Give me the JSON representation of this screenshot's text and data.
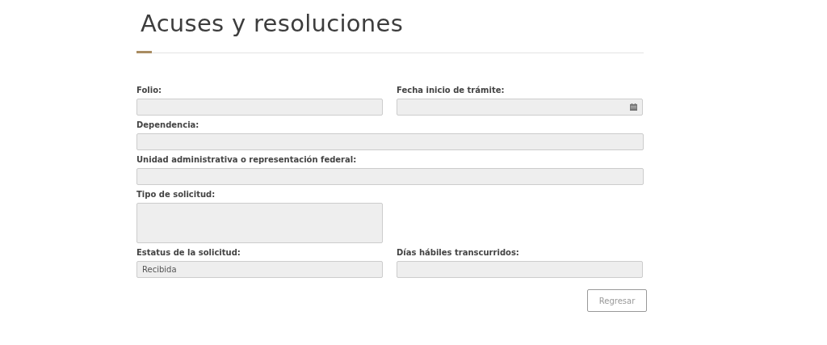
{
  "title": "Acuses y resoluciones",
  "rows": [
    [
      {
        "label": "Folio:",
        "kind": "text"
      },
      {
        "label": "Fecha inicio de trámite:",
        "kind": "date"
      }
    ],
    [
      {
        "label": "Dependencia:",
        "kind": "text"
      }
    ],
    [
      {
        "label": "Unidad administrativa o representación federal:",
        "kind": "text"
      }
    ],
    [
      {
        "label": "Tipo de solicitud:",
        "kind": "textarea"
      }
    ],
    [
      {
        "label": "Estatus de la solicitud:",
        "kind": "text",
        "value": "Recibida"
      },
      {
        "label": "Días hábiles transcurridos:",
        "kind": "text"
      }
    ]
  ],
  "buttons": [
    "Regresar"
  ]
}
